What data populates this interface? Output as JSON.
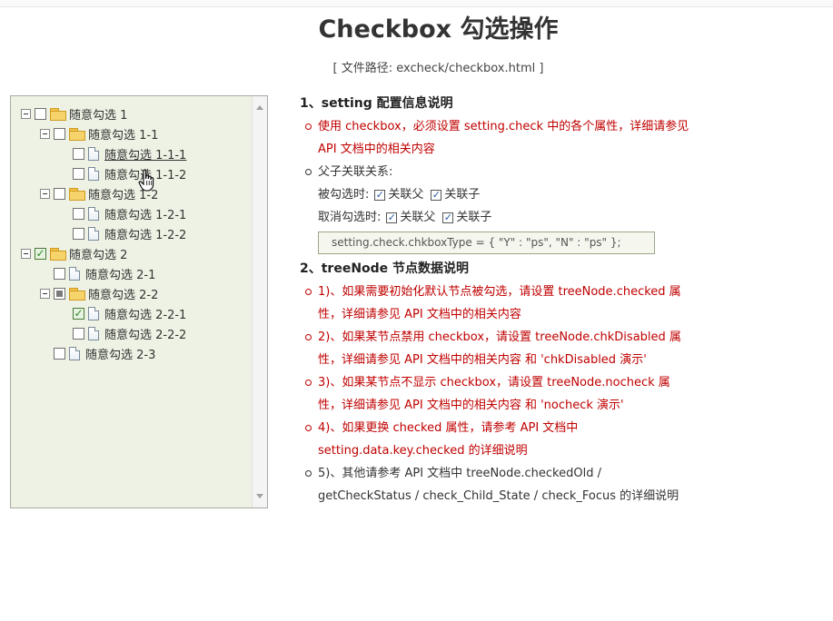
{
  "page": {
    "title": "Checkbox 勾选操作",
    "file_path": "[ 文件路径: excheck/checkbox.html ]"
  },
  "tree": {
    "nodes": [
      {
        "label": "随意勾选 1",
        "type": "folder",
        "state": "unchecked",
        "expanded": true
      },
      {
        "label": "随意勾选 1-1",
        "type": "folder",
        "state": "unchecked",
        "expanded": true
      },
      {
        "label": "随意勾选 1-1-1",
        "type": "leaf",
        "state": "unchecked"
      },
      {
        "label": "随意勾选 1-1-2",
        "type": "leaf",
        "state": "unchecked"
      },
      {
        "label": "随意勾选 1-2",
        "type": "folder",
        "state": "unchecked",
        "expanded": true
      },
      {
        "label": "随意勾选 1-2-1",
        "type": "leaf",
        "state": "unchecked"
      },
      {
        "label": "随意勾选 1-2-2",
        "type": "leaf",
        "state": "unchecked"
      },
      {
        "label": "随意勾选 2",
        "type": "folder",
        "state": "checked",
        "expanded": true
      },
      {
        "label": "随意勾选 2-1",
        "type": "leaf",
        "state": "unchecked"
      },
      {
        "label": "随意勾选 2-2",
        "type": "folder",
        "state": "partial",
        "expanded": true
      },
      {
        "label": "随意勾选 2-2-1",
        "type": "leaf",
        "state": "checked"
      },
      {
        "label": "随意勾选 2-2-2",
        "type": "leaf",
        "state": "unchecked"
      },
      {
        "label": "随意勾选 2-3",
        "type": "leaf",
        "state": "unchecked"
      }
    ]
  },
  "section1": {
    "title": "1、setting 配置信息说明",
    "item1": "使用 checkbox，必须设置 setting.check 中的各个属性，详细请参见 API 文档中的相关内容",
    "item2": "父子关联关系:",
    "checked_row": {
      "label": "被勾选时:",
      "opt1": "关联父",
      "opt2": "关联子"
    },
    "unchecked_row": {
      "label": "取消勾选时:",
      "opt1": "关联父",
      "opt2": "关联子"
    },
    "code": "setting.check.chkboxType = { \"Y\" : \"ps\", \"N\" : \"ps\" };"
  },
  "section2": {
    "title": "2、treeNode 节点数据说明",
    "items": [
      {
        "text": "1)、如果需要初始化默认节点被勾选，请设置 treeNode.checked 属性，详细请参见 API 文档中的相关内容",
        "color": "red"
      },
      {
        "text": "2)、如果某节点禁用 checkbox，请设置 treeNode.chkDisabled 属性，详细请参见 API 文档中的相关内容 和 'chkDisabled 演示'",
        "color": "red"
      },
      {
        "text": "3)、如果某节点不显示 checkbox，请设置 treeNode.nocheck 属性，详细请参见 API 文档中的相关内容 和 'nocheck 演示'",
        "color": "red"
      },
      {
        "text": "4)、如果更换 checked 属性，请参考 API 文档中 setting.data.key.checked 的详细说明",
        "color": "red"
      },
      {
        "text": "5)、其他请参考 API 文档中 treeNode.checkedOld / getCheckStatus / check_Child_State / check_Focus 的详细说明",
        "color": "gray"
      }
    ]
  },
  "colors": {
    "accent_red": "#c00000",
    "tree_bg": "#eef2e4",
    "folder": "#f7d36b"
  }
}
